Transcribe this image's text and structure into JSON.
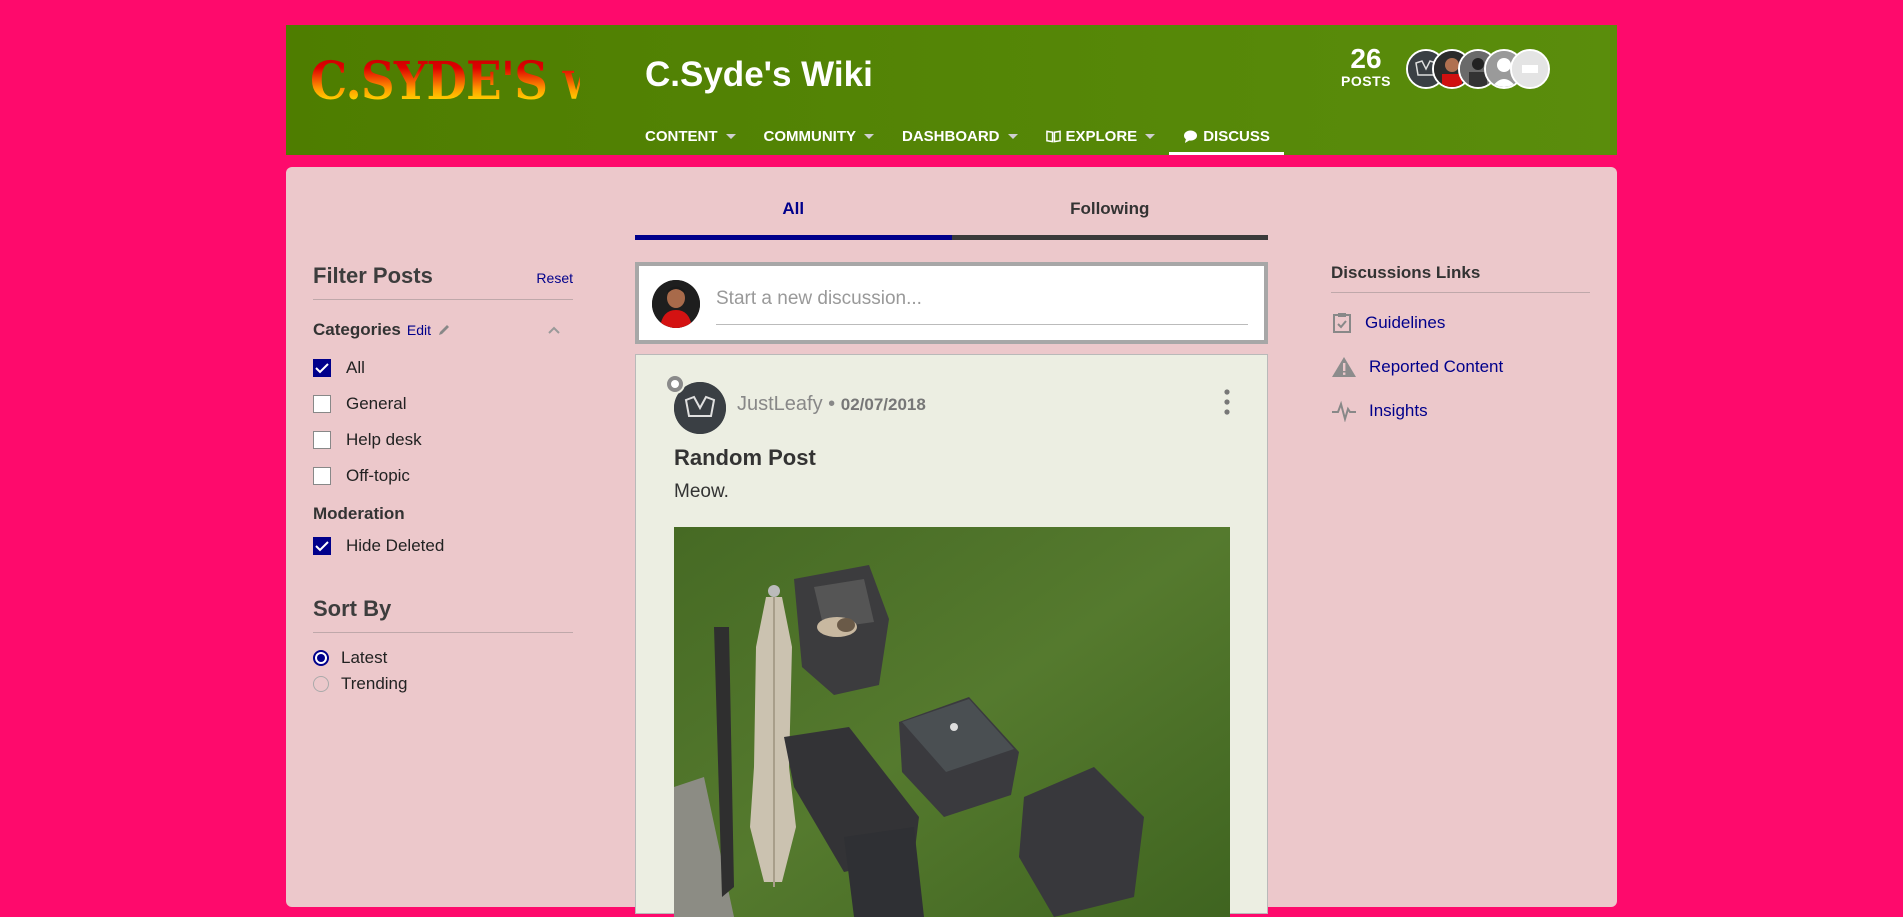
{
  "header": {
    "logo_text": "C.SYDE'S WIKI",
    "site_title": "C.Syde's Wiki",
    "posts_count": "26",
    "posts_label": "POSTS",
    "nav": [
      {
        "label": "CONTENT",
        "has_caret": true
      },
      {
        "label": "COMMUNITY",
        "has_caret": true
      },
      {
        "label": "DASHBOARD",
        "has_caret": true
      },
      {
        "label": "EXPLORE",
        "has_caret": true,
        "icon": "book-icon"
      },
      {
        "label": "DISCUSS",
        "has_caret": false,
        "icon": "speech-bubble-icon",
        "active": true
      }
    ]
  },
  "filter": {
    "title": "Filter Posts",
    "reset": "Reset",
    "categories_title": "Categories",
    "edit": "Edit",
    "categories": [
      {
        "label": "All",
        "checked": true
      },
      {
        "label": "General",
        "checked": false
      },
      {
        "label": "Help desk",
        "checked": false
      },
      {
        "label": "Off-topic",
        "checked": false
      }
    ],
    "moderation_title": "Moderation",
    "moderation": [
      {
        "label": "Hide Deleted",
        "checked": true
      }
    ],
    "sort_title": "Sort By",
    "sort_options": [
      {
        "label": "Latest",
        "selected": true
      },
      {
        "label": "Trending",
        "selected": false
      }
    ]
  },
  "tabs": [
    {
      "label": "All",
      "active": true
    },
    {
      "label": "Following",
      "active": false
    }
  ],
  "composer": {
    "placeholder": "Start a new discussion..."
  },
  "post": {
    "author": "JustLeafy",
    "separator": "•",
    "date": "02/07/2018",
    "title": "Random Post",
    "body": "Meow."
  },
  "links": {
    "title": "Discussions Links",
    "items": [
      {
        "label": "Guidelines",
        "icon": "clipboard-check-icon"
      },
      {
        "label": "Reported Content",
        "icon": "warning-icon"
      },
      {
        "label": "Insights",
        "icon": "pulse-icon"
      }
    ]
  },
  "colors": {
    "page_bg": "#fe0a6c",
    "header_bg": "#5a8d0c",
    "panel_bg": "#ecc8cb",
    "accent": "#00008b"
  }
}
